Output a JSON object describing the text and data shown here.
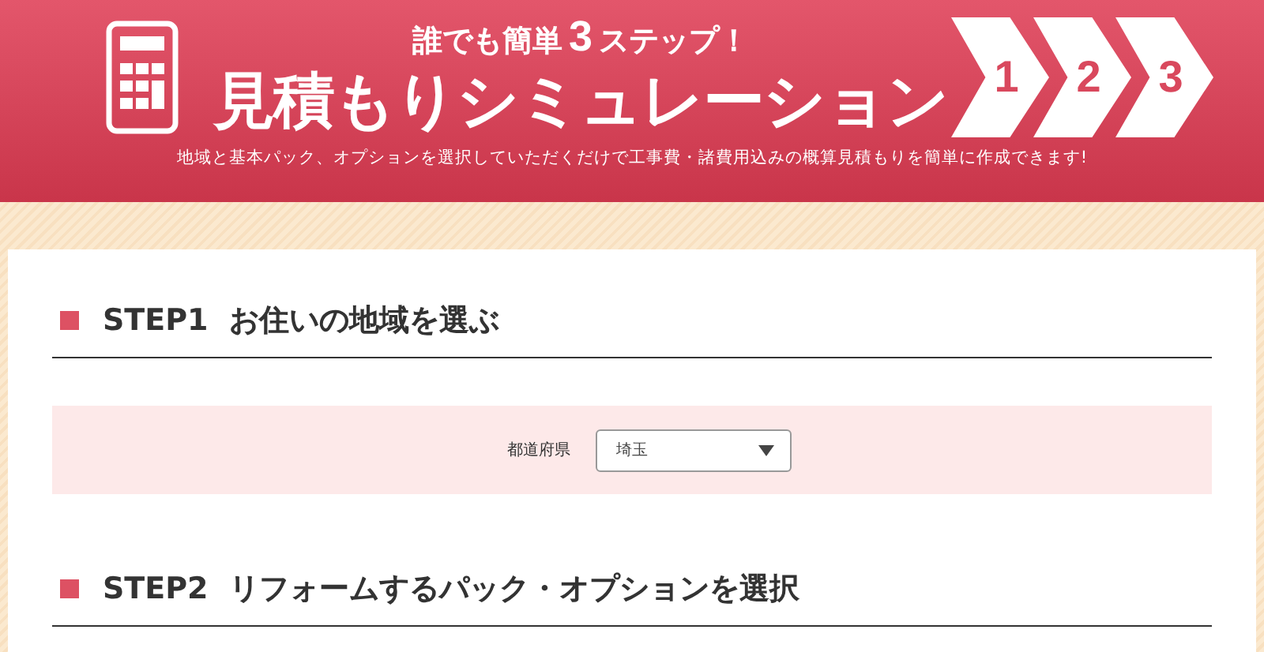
{
  "header": {
    "tagline": {
      "before": "誰でも簡単",
      "number": "3",
      "after": "ステップ！"
    },
    "title": "見積もりシミュレーション",
    "steps": [
      "1",
      "2",
      "3"
    ],
    "description": "地域と基本パック、オプションを選択していただくだけで工事費・諸費用込みの概算見積もりを簡単に作成できます!"
  },
  "sections": [
    {
      "heading": "STEP1  お住いの地域を選ぶ",
      "field": {
        "label": "都道府県",
        "value": "埼玉"
      }
    },
    {
      "heading": "STEP2  リフォームするパック・オプションを選択"
    }
  ]
}
